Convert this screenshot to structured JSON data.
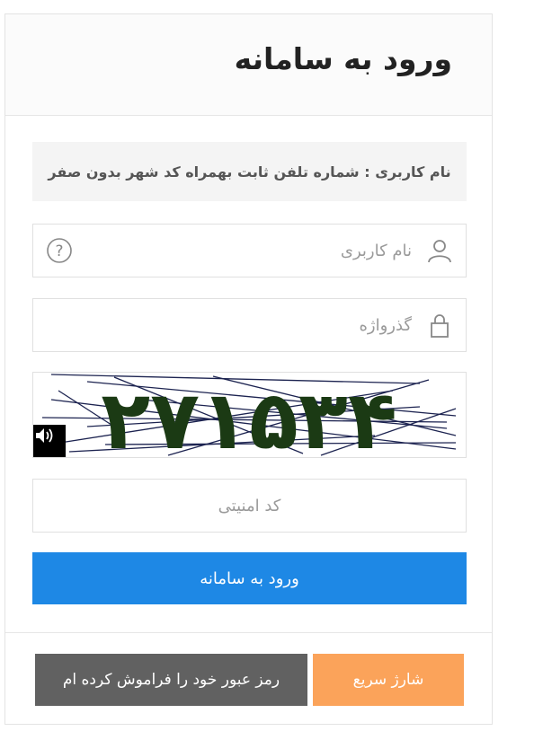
{
  "header": {
    "title": "ورود به سامانه"
  },
  "notice": {
    "text": "نام کاربری : شماره تلفن ثابت بهمراه کد شهر بدون صفر"
  },
  "username": {
    "placeholder": "نام کاربری",
    "icon": "user-icon",
    "help_icon": "question-circle-icon"
  },
  "password": {
    "placeholder": "گذرواژه",
    "icon": "lock-icon"
  },
  "captcha": {
    "code": "۲۷۱۵۳۴",
    "audio_icon": "speaker-icon",
    "text_color": "#1b3a14"
  },
  "security_code": {
    "placeholder": "کد امنیتی"
  },
  "buttons": {
    "login": "ورود به سامانه",
    "forgot_password": "رمز عبور خود را فراموش کرده ام",
    "quick_charge": "شارژ سریع"
  },
  "colors": {
    "primary": "#1e88e5",
    "secondary": "#616161",
    "accent": "#fba35a"
  }
}
